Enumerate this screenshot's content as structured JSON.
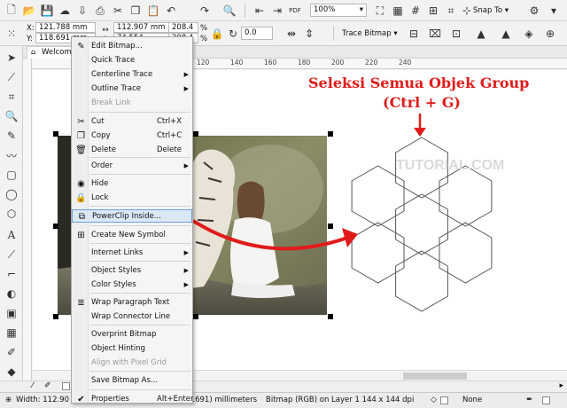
{
  "toolbar": {
    "zoom_value": "100%",
    "snap_label": "Snap To",
    "pdf_label": "PDF",
    "x_label": "X:",
    "y_label": "Y:",
    "x_value": "121.788 mm",
    "y_value": "118.691 mm",
    "w_value": "112.907 mm",
    "h_value": "74.554",
    "scale_x": "208.4",
    "scale_y": "208.4",
    "pct_x": "%",
    "pct_y": "%",
    "angle_value": "0.0",
    "trace_bitmap_label": "Trace Bitmap"
  },
  "tabs": {
    "welcome": "Welcome"
  },
  "ruler": {
    "ticks": [
      "120",
      "140",
      "160",
      "180",
      "200",
      "220",
      "240"
    ]
  },
  "context_menu": {
    "items": [
      {
        "label": "Edit Bitmap...",
        "icon": "edit-bitmap-icon"
      },
      {
        "label": "Quick Trace"
      },
      {
        "label": "Centerline Trace",
        "submenu": true
      },
      {
        "label": "Outline Trace",
        "submenu": true
      },
      {
        "label": "Break Link",
        "disabled": true
      },
      {
        "label": "Cut",
        "shortcut": "Ctrl+X",
        "icon": "cut-icon"
      },
      {
        "label": "Copy",
        "shortcut": "Ctrl+C",
        "icon": "copy-icon"
      },
      {
        "label": "Delete",
        "shortcut": "Delete",
        "icon": "delete-icon"
      },
      {
        "label": "Order",
        "submenu": true
      },
      {
        "label": "Hide",
        "icon": "hide-icon"
      },
      {
        "label": "Lock",
        "icon": "lock-icon"
      },
      {
        "label": "PowerClip Inside...",
        "icon": "powerclip-icon",
        "highlighted": true
      },
      {
        "label": "Create New Symbol",
        "icon": "symbol-icon"
      },
      {
        "label": "Internet Links",
        "submenu": true
      },
      {
        "label": "Object Styles",
        "submenu": true
      },
      {
        "label": "Color Styles",
        "submenu": true
      },
      {
        "label": "Wrap Paragraph Text",
        "icon": "wrap-icon"
      },
      {
        "label": "Wrap Connector Line"
      },
      {
        "label": "Overprint Bitmap"
      },
      {
        "label": "Object Hinting"
      },
      {
        "label": "Align with Pixel Grid",
        "disabled": true
      },
      {
        "label": "Save Bitmap As..."
      },
      {
        "label": "Properties",
        "shortcut": "Alt+Enter",
        "icon": "check-icon"
      }
    ]
  },
  "annotation": {
    "line1": "Seleksi Semua Objek Group",
    "line2": "(Ctrl + G)"
  },
  "watermark": "TUTORIAL.COM",
  "statusbar": {
    "width_text": "Width: 112.90",
    "coords_text": "8.691)  millimeters",
    "bitmap_info": "Bitmap (RGB) on Layer 1 144 x 144 dpi",
    "fill_none": "None"
  },
  "colors": {
    "annotation_red": "#e11b1b",
    "highlight_bg": "#dbe9f7",
    "highlight_border": "#6aa1d8"
  }
}
